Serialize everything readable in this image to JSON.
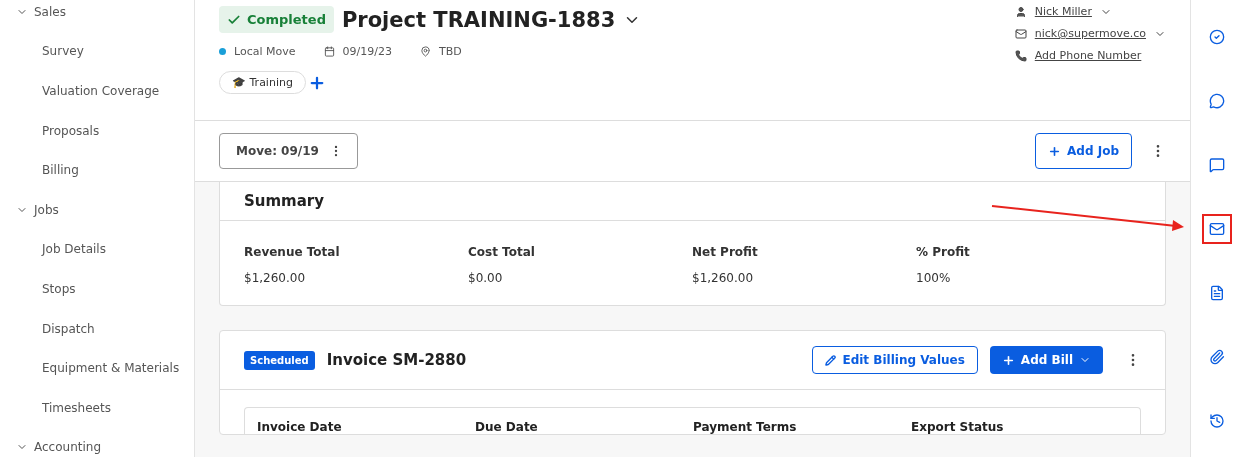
{
  "sidebar": {
    "groups": [
      {
        "label": "Sales",
        "expanded": true,
        "children": [
          {
            "label": "Survey"
          },
          {
            "label": "Valuation Coverage"
          },
          {
            "label": "Proposals"
          },
          {
            "label": "Billing"
          }
        ]
      },
      {
        "label": "Jobs",
        "expanded": true,
        "children": [
          {
            "label": "Job Details"
          },
          {
            "label": "Stops"
          },
          {
            "label": "Dispatch"
          },
          {
            "label": "Equipment & Materials"
          },
          {
            "label": "Timesheets"
          }
        ]
      },
      {
        "label": "Accounting",
        "expanded": true
      }
    ]
  },
  "header": {
    "status": "Completed",
    "title": "Project TRAINING-1883",
    "meta": [
      {
        "kind": "dot",
        "text": "Local Move",
        "color": "#1a9fd8"
      },
      {
        "kind": "date",
        "text": "09/19/23"
      },
      {
        "kind": "pin",
        "text": "TBD"
      }
    ],
    "tags": [
      {
        "emoji": "🎓",
        "label": "Training"
      }
    ],
    "contacts": [
      {
        "kind": "user",
        "text": "Nick Miller",
        "dropdown": true
      },
      {
        "kind": "mail",
        "text": "nick@supermove.co",
        "dropdown": true
      },
      {
        "kind": "phone",
        "text": "Add Phone Number",
        "dropdown": false
      }
    ]
  },
  "toolbar": {
    "job": "Move: 09/19",
    "add_button": "Add Job"
  },
  "summary": {
    "title": "Summary",
    "metrics": [
      {
        "label": "Revenue Total",
        "value": "$1,260.00"
      },
      {
        "label": "Cost Total",
        "value": "$0.00"
      },
      {
        "label": "Net Profit",
        "value": "$1,260.00"
      },
      {
        "label": "% Profit",
        "value": "100%"
      }
    ]
  },
  "invoice": {
    "badge": "Scheduled",
    "title": "Invoice SM-2880",
    "edit_button": "Edit Billing Values",
    "add_button": "Add Bill",
    "columns": [
      "Invoice Date",
      "Due Date",
      "Payment Terms",
      "Export Status"
    ]
  },
  "rail": [
    {
      "kind": "check",
      "highlighted": false
    },
    {
      "kind": "chat",
      "highlighted": false
    },
    {
      "kind": "sms",
      "highlighted": false
    },
    {
      "kind": "mail",
      "highlighted": true
    },
    {
      "kind": "file",
      "highlighted": false
    },
    {
      "kind": "clip",
      "highlighted": false
    },
    {
      "kind": "history",
      "highlighted": false
    }
  ],
  "annotation": {
    "kind": "arrow"
  }
}
